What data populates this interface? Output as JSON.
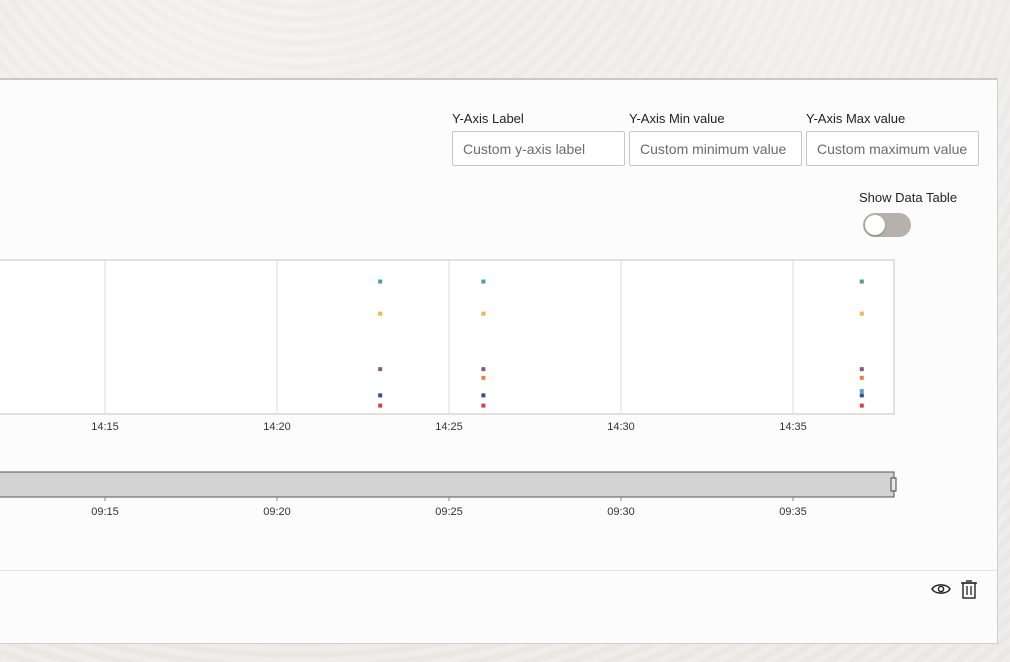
{
  "controls": {
    "y_axis_label": {
      "label": "Y-Axis Label",
      "placeholder": "Custom y-axis label"
    },
    "y_axis_min": {
      "label": "Y-Axis Min value",
      "placeholder": "Custom minimum value"
    },
    "y_axis_max": {
      "label": "Y-Axis Max value",
      "placeholder": "Custom maximum value"
    },
    "show_data_table": {
      "label": "Show Data Table",
      "enabled": false
    }
  },
  "chart_data": {
    "type": "scatter",
    "x_ticks": [
      "14:15",
      "14:20",
      "14:25",
      "14:30",
      "14:35"
    ],
    "x_range": [
      "14:10",
      "14:38"
    ],
    "series": [
      {
        "color": "#4aa392",
        "points": [
          {
            "x": "14:23",
            "y": 0.88
          },
          {
            "x": "14:26",
            "y": 0.88
          },
          {
            "x": "14:37",
            "y": 0.88
          }
        ]
      },
      {
        "color": "#f0b54a",
        "points": [
          {
            "x": "14:23",
            "y": 0.66
          },
          {
            "x": "14:26",
            "y": 0.66
          },
          {
            "x": "14:37",
            "y": 0.66
          }
        ]
      },
      {
        "color": "#8b5a7a",
        "points": [
          {
            "x": "14:23",
            "y": 0.28
          },
          {
            "x": "14:26",
            "y": 0.28
          },
          {
            "x": "14:37",
            "y": 0.28
          }
        ]
      },
      {
        "color": "#e6843e",
        "points": [
          {
            "x": "14:26",
            "y": 0.22
          },
          {
            "x": "14:37",
            "y": 0.22
          }
        ]
      },
      {
        "color": "#5aa6c8",
        "points": [
          {
            "x": "14:37",
            "y": 0.13
          }
        ]
      },
      {
        "color": "#2f4f8f",
        "points": [
          {
            "x": "14:23",
            "y": 0.1
          },
          {
            "x": "14:26",
            "y": 0.1
          },
          {
            "x": "14:37",
            "y": 0.1
          }
        ]
      },
      {
        "color": "#d2433f",
        "points": [
          {
            "x": "14:23",
            "y": 0.03
          },
          {
            "x": "14:26",
            "y": 0.03
          },
          {
            "x": "14:37",
            "y": 0.03
          }
        ]
      }
    ],
    "grid": true
  },
  "overview": {
    "x_ticks": [
      "09:15",
      "09:20",
      "09:25",
      "09:30",
      "09:35"
    ]
  },
  "footer": {
    "view_icon": "eye-icon",
    "delete_icon": "trash-icon"
  }
}
